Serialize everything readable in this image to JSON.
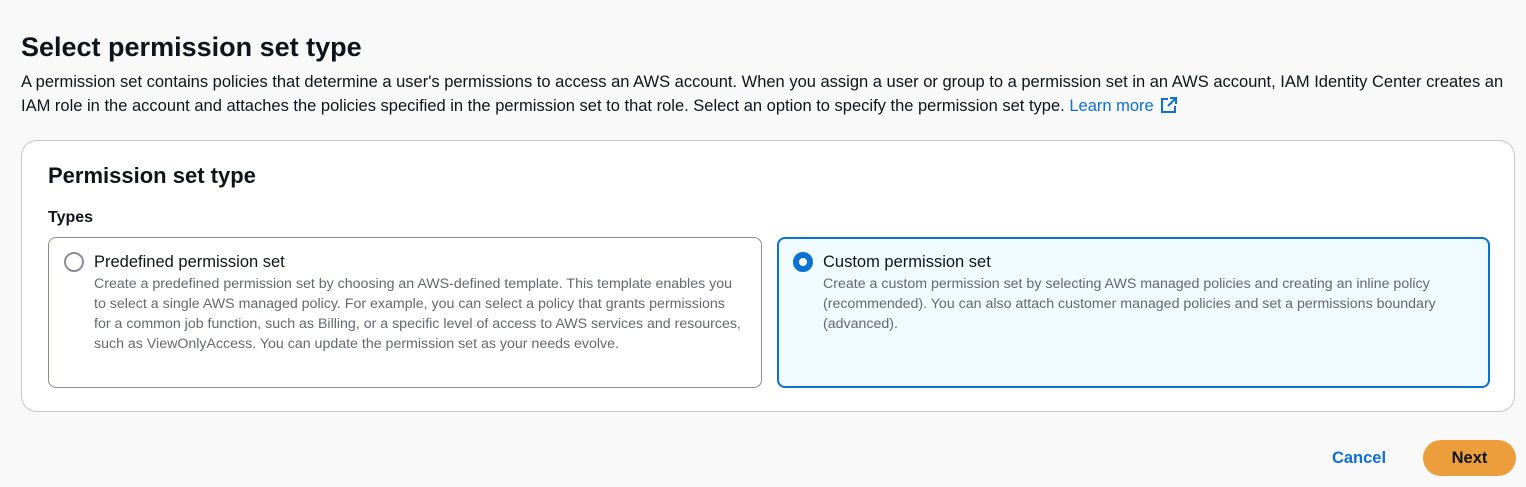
{
  "header": {
    "title": "Select permission set type",
    "description": "A permission set contains policies that determine a user's permissions to access an AWS account. When you assign a user or group to a permission set in an AWS account, IAM Identity Center creates an IAM role in the account and attaches the policies specified in the permission set to that role. Select an option to specify the permission set type.",
    "learn_more": "Learn more",
    "learn_more_icon": "external-link-icon"
  },
  "panel": {
    "title": "Permission set type",
    "types_label": "Types",
    "options": [
      {
        "title": "Predefined permission set",
        "description": "Create a predefined permission set by choosing an AWS-defined template. This template enables you to select a single AWS managed policy. For example, you can select a policy that grants permissions for a common job function, such as Billing, or a specific level of access to AWS services and resources, such as ViewOnlyAccess. You can update the permission set as your needs evolve.",
        "selected": false
      },
      {
        "title": "Custom permission set",
        "description": "Create a custom permission set by selecting AWS managed policies and creating an inline policy (recommended). You can also attach customer managed policies and set a permissions boundary (advanced).",
        "selected": true
      }
    ]
  },
  "actions": {
    "cancel_label": "Cancel",
    "next_label": "Next"
  },
  "colors": {
    "accent": "#0972d3",
    "primary_button": "#ec9e3d",
    "selected_tile_bg": "#f0fbff"
  }
}
